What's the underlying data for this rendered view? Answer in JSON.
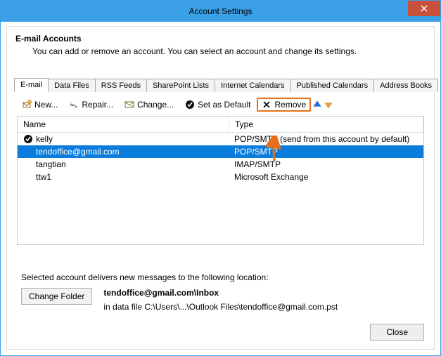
{
  "window": {
    "title": "Account Settings"
  },
  "header": {
    "title": "E-mail Accounts",
    "desc": "You can add or remove an account. You can select an account and change its settings."
  },
  "tabs": [
    {
      "label": "E-mail",
      "active": true
    },
    {
      "label": "Data Files"
    },
    {
      "label": "RSS Feeds"
    },
    {
      "label": "SharePoint Lists"
    },
    {
      "label": "Internet Calendars"
    },
    {
      "label": "Published Calendars"
    },
    {
      "label": "Address Books"
    }
  ],
  "toolbar": {
    "new": "New...",
    "repair": "Repair...",
    "change": "Change...",
    "set_default": "Set as Default",
    "remove": "Remove"
  },
  "columns": {
    "name": "Name",
    "type": "Type"
  },
  "accounts": [
    {
      "name": "kelly",
      "type": "POP/SMTP (send from this account by default)",
      "default": true,
      "selected": false
    },
    {
      "name": "tendoffice@gmail.com",
      "type": "POP/SMTP",
      "default": false,
      "selected": true
    },
    {
      "name": "tangtian",
      "type": "IMAP/SMTP",
      "default": false,
      "selected": false
    },
    {
      "name": "ttw1",
      "type": "Microsoft Exchange",
      "default": false,
      "selected": false
    }
  ],
  "delivery": {
    "intro": "Selected account delivers new messages to the following location:",
    "change_folder": "Change Folder",
    "path_bold": "tendoffice@gmail.com\\Inbox",
    "path_file": "in data file C:\\Users\\...\\Outlook Files\\tendoffice@gmail.com.pst"
  },
  "buttons": {
    "close": "Close"
  }
}
